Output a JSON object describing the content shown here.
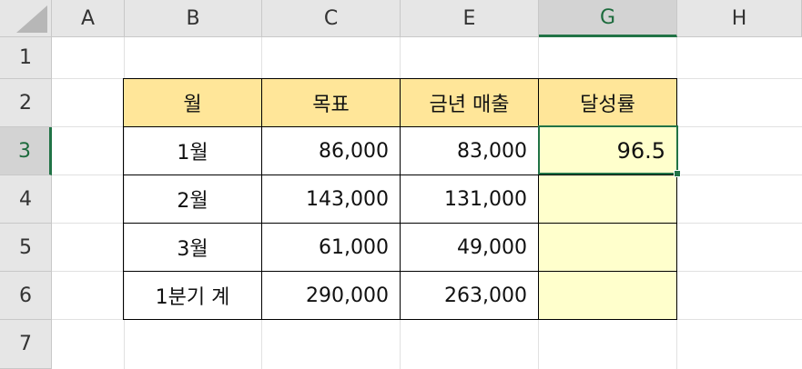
{
  "columns": [
    "A",
    "B",
    "C",
    "E",
    "G",
    "H"
  ],
  "rows": [
    "1",
    "2",
    "3",
    "4",
    "5",
    "6",
    "7"
  ],
  "table": {
    "headers": [
      "월",
      "목표",
      "금년 매출",
      "달성률"
    ],
    "rows": [
      {
        "month": "1월",
        "target": "86,000",
        "sales": "83,000",
        "rate": "96.5"
      },
      {
        "month": "2월",
        "target": "143,000",
        "sales": "131,000",
        "rate": ""
      },
      {
        "month": "3월",
        "target": "61,000",
        "sales": "49,000",
        "rate": ""
      },
      {
        "month": "1분기 계",
        "target": "290,000",
        "sales": "263,000",
        "rate": ""
      }
    ]
  },
  "active_cell": {
    "column": "G",
    "row": "3"
  },
  "colors": {
    "header_fill": "#ffe699",
    "result_fill": "#ffffcc",
    "selection": "#217346"
  }
}
